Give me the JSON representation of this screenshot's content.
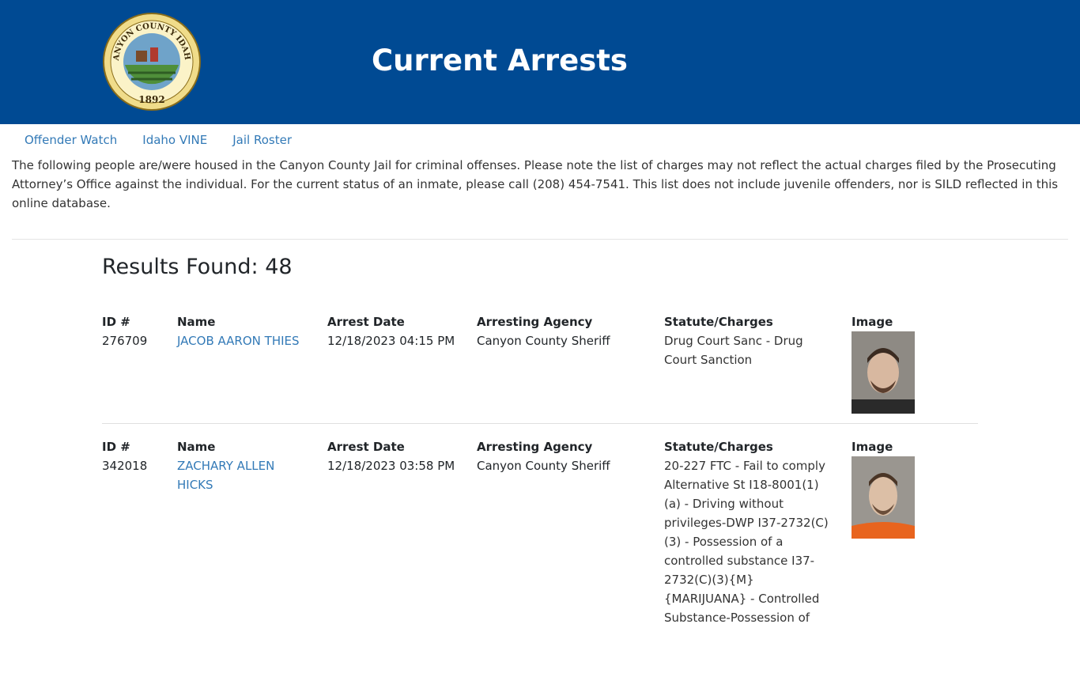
{
  "header": {
    "title": "Current Arrests",
    "seal": {
      "top_text": "CANYON COUNTY IDAHO",
      "year": "1892"
    }
  },
  "nav": {
    "items": [
      "Offender Watch",
      "Idaho VINE",
      "Jail Roster"
    ]
  },
  "intro": "The following people are/were housed in the Canyon County Jail for criminal offenses. Please note the list of charges may not reflect the actual charges filed by the Prosecuting Attorney’s Office against the individual. For the current status of an inmate, please call (208) 454-7541. This list does not include juvenile offenders, nor is SILD reflected in this online database.",
  "results_label": "Results Found: 48",
  "columns": {
    "id": "ID #",
    "name": "Name",
    "date": "Arrest Date",
    "agency": "Arresting Agency",
    "charges": "Statute/Charges",
    "image": "Image"
  },
  "records": [
    {
      "id": "276709",
      "name": "JACOB AARON THIES",
      "date": "12/18/2023 04:15 PM",
      "agency": "Canyon County Sheriff",
      "charges": "Drug Court Sanc - Drug Court Sanction"
    },
    {
      "id": "342018",
      "name": "ZACHARY ALLEN HICKS",
      "date": "12/18/2023 03:58 PM",
      "agency": "Canyon County Sheriff",
      "charges": "20-227 FTC - Fail to comply Alternative St I18-8001(1)(a) - Driving without privileges-DWP I37-2732(C)(3) - Possession of a controlled substance I37-2732(C)(3){M}{MARIJUANA} - Controlled Substance-Possession of"
    }
  ],
  "colors": {
    "header_bg": "#004a93",
    "link": "#337ab7",
    "seal_gold": "#c9a227"
  }
}
